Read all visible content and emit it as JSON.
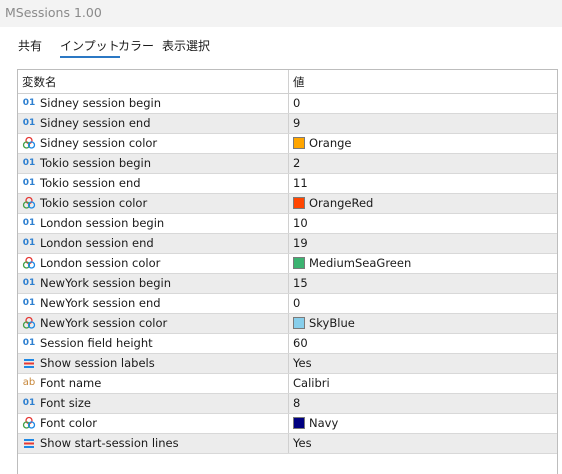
{
  "window": {
    "title": "MSessions 1.00"
  },
  "tabs": [
    {
      "label": "共有",
      "active": false
    },
    {
      "label": "インプット",
      "active": true
    },
    {
      "label": "カラー",
      "active": false
    },
    {
      "label": "表示選択",
      "active": false
    }
  ],
  "grid": {
    "header": {
      "name": "変数名",
      "value": "値"
    },
    "rows": [
      {
        "icon": "int-icon",
        "name": "Sidney session begin",
        "value": "0"
      },
      {
        "icon": "int-icon",
        "name": "Sidney session end",
        "value": "9"
      },
      {
        "icon": "color-icon",
        "name": "Sidney session color",
        "value": "Orange",
        "swatch": "#ffa500"
      },
      {
        "icon": "int-icon",
        "name": "Tokio session begin",
        "value": "2"
      },
      {
        "icon": "int-icon",
        "name": "Tokio session end",
        "value": "11"
      },
      {
        "icon": "color-icon",
        "name": "Tokio session color",
        "value": "OrangeRed",
        "swatch": "#ff4500"
      },
      {
        "icon": "int-icon",
        "name": "London session begin",
        "value": "10"
      },
      {
        "icon": "int-icon",
        "name": "London session end",
        "value": "19"
      },
      {
        "icon": "color-icon",
        "name": "London session color",
        "value": "MediumSeaGreen",
        "swatch": "#3cb371"
      },
      {
        "icon": "int-icon",
        "name": "NewYork session begin",
        "value": "15"
      },
      {
        "icon": "int-icon",
        "name": "NewYork session end",
        "value": "0"
      },
      {
        "icon": "color-icon",
        "name": "NewYork session color",
        "value": "SkyBlue",
        "swatch": "#87ceeb"
      },
      {
        "icon": "int-icon",
        "name": "Session field height",
        "value": "60"
      },
      {
        "icon": "enum-icon",
        "name": "Show session labels",
        "value": "Yes"
      },
      {
        "icon": "string-icon",
        "name": "Font name",
        "value": "Calibri"
      },
      {
        "icon": "int-icon",
        "name": "Font size",
        "value": "8"
      },
      {
        "icon": "color-icon",
        "name": "Font color",
        "value": "Navy",
        "swatch": "#000080"
      },
      {
        "icon": "enum-icon",
        "name": "Show start-session lines",
        "value": "Yes"
      }
    ]
  }
}
